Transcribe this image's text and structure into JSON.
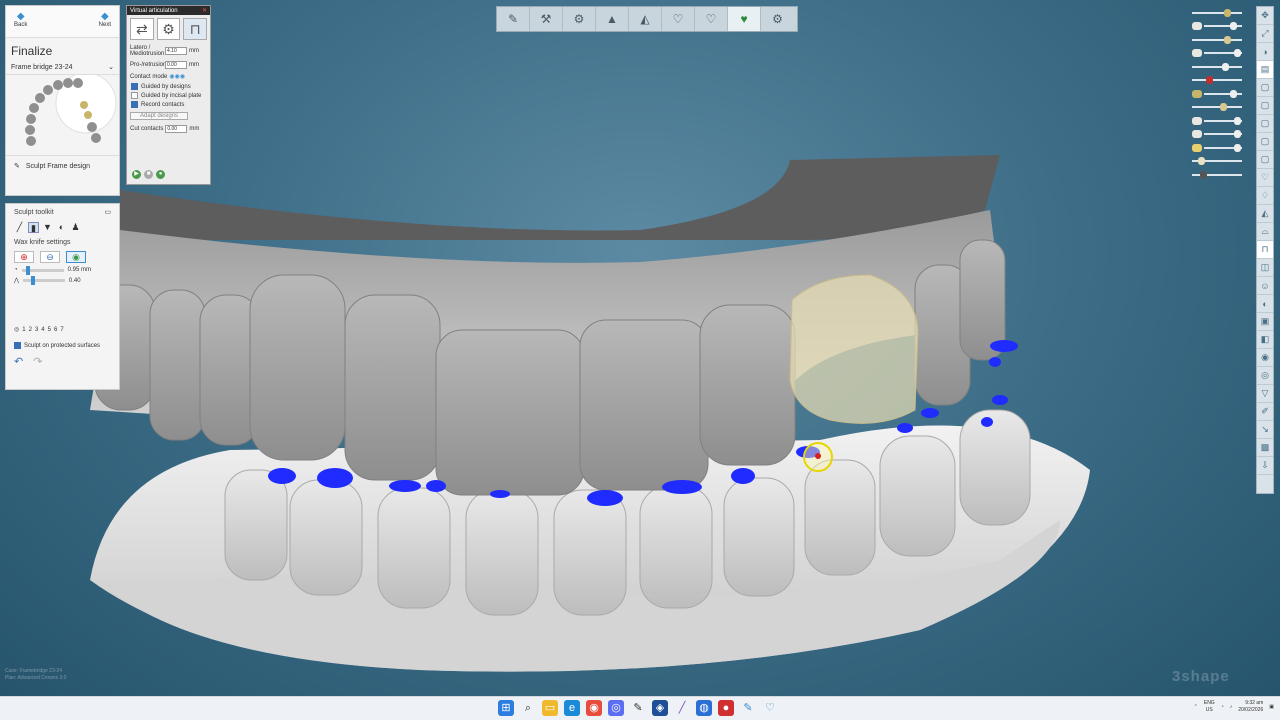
{
  "left_panel": {
    "back_label": "Back",
    "next_label": "Next",
    "title": "Finalize",
    "select_value": "Frame bridge 23-24",
    "sculpt_frame_label": "Sculpt Frame design"
  },
  "sculpt_toolkit": {
    "title": "Sculpt toolkit",
    "settings_title": "Wax knife settings",
    "value_1": "0.95 mm",
    "value_2": "0.40",
    "level_1": 0.1,
    "level_2": 0.2,
    "numbers": [
      "1",
      "2",
      "3",
      "4",
      "5",
      "6",
      "7"
    ],
    "sculpt_protected_label": "Sculpt on protected surfaces"
  },
  "articulation": {
    "title": "Virtual articulation",
    "latero_label": "Latero / Mediotrusion",
    "latero_value": "4.10",
    "latero_unit": "mm",
    "protrusion_label": "Pro-/retrusion",
    "protrusion_value": "0.00",
    "protrusion_unit": "mm",
    "contact_mode_label": "Contact mode",
    "guided_designs_label": "Guided by designs",
    "guided_incisal_label": "Guided by incisal plate",
    "record_contacts_label": "Record contacts",
    "adapt_designs_label": "Adapt designs",
    "cut_contacts_label": "Cut contacts",
    "cut_contacts_value": "0.00",
    "cut_contacts_unit": "mm"
  },
  "status": {
    "line1": "Case: Framebridge 23-24",
    "line2": "Plan: Advanced Crowns 3.0"
  },
  "logo_text": "3shape",
  "tray": {
    "lang_1": "ENG",
    "lang_2": "US",
    "time": "9:32 am",
    "date": "20/02/2026"
  },
  "colors": {
    "background": "#3e6e88",
    "contact_blue": "#1f2bff",
    "accent": "#3a8fd0"
  },
  "icons": {
    "top_toolbar": [
      "brush-icon",
      "articulator-icon",
      "articulator-2-icon",
      "model-icon",
      "model-2-icon",
      "tooth-icon",
      "tooth-2-icon",
      "tooth-active-icon",
      "settings-icon"
    ],
    "taskbar": [
      "windows-icon",
      "search-icon",
      "files-icon",
      "edge-icon",
      "chrome-icon",
      "app-icon",
      "notepad-icon",
      "app2-icon",
      "pen-icon",
      "browser-icon",
      "record-icon",
      "app3-icon",
      "app4-icon"
    ]
  }
}
